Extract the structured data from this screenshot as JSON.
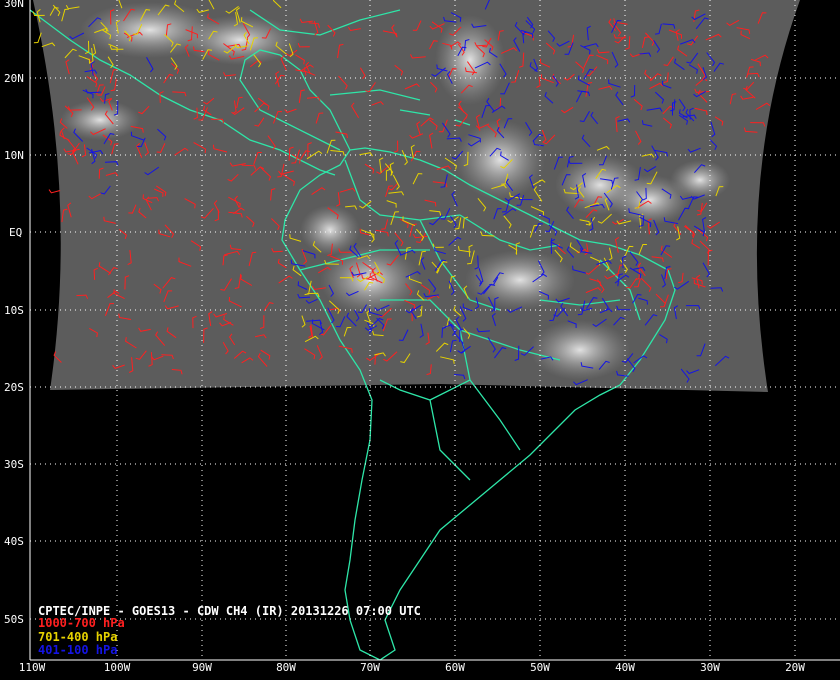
{
  "caption": "CPTEC/INPE - GOES13 - CDW CH4 (IR) 20131226 07:00 UTC",
  "legend": [
    {
      "label": "1000-700 hPa",
      "color": "#ff2020"
    },
    {
      "label": "701-400 hPa",
      "color": "#e6d200"
    },
    {
      "label": "401-100 hPa",
      "color": "#1414e6"
    }
  ],
  "lat_labels": [
    "30N",
    "20N",
    "10N",
    "EQ",
    "10S",
    "20S",
    "30S",
    "40S",
    "50S"
  ],
  "lon_labels": [
    "110W",
    "100W",
    "90W",
    "80W",
    "70W",
    "60W",
    "50W",
    "40W",
    "30W",
    "20W"
  ],
  "colors": {
    "background": "#000000",
    "coastline": "#2ee6a8",
    "grid": "#ffffff",
    "imagery": "#5a5a5a"
  }
}
